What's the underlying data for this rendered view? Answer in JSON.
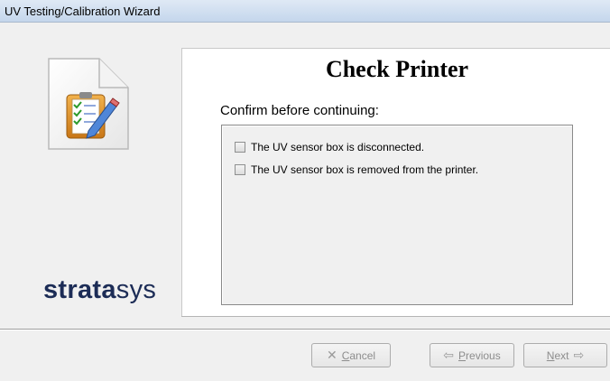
{
  "window": {
    "title": "UV Testing/Calibration Wizard"
  },
  "brand": {
    "logo_bold": "strata",
    "logo_light": "sys"
  },
  "page": {
    "heading": "Check Printer",
    "instruction": "Confirm before continuing:",
    "checks": [
      {
        "label": "The UV sensor box is disconnected.",
        "checked": false
      },
      {
        "label": "The UV sensor box is removed from the printer.",
        "checked": false
      }
    ]
  },
  "buttons": {
    "cancel": {
      "icon": "cancel-icon",
      "accel": "C",
      "rest": "ancel",
      "enabled": false
    },
    "previous": {
      "icon": "previous-arrow-icon",
      "accel": "P",
      "rest": "revious",
      "enabled": false
    },
    "next": {
      "icon": "next-arrow-icon",
      "accel": "N",
      "rest": "ext",
      "enabled": false
    }
  }
}
